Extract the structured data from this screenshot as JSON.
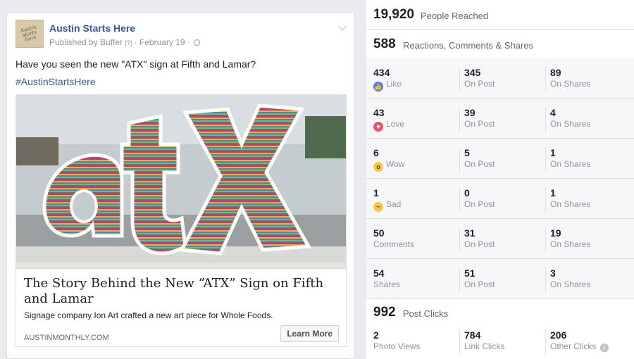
{
  "post": {
    "page_name": "Austin Starts Here",
    "avatar_text": "Austin starts here",
    "published_by": "Published by Buffer",
    "help_mark": "[?]",
    "separator": "·",
    "date": "February 19",
    "text": "Have you seen the new \"ATX\" sign at Fifth and Lamar?",
    "hashtag": "#AustinStartsHere",
    "link": {
      "title": "The Story Behind the New “ATX” Sign on Fifth and Lamar",
      "description": "Signage company Ion Art crafted a new art piece for Whole Foods.",
      "domain": "AUSTINMONTHLY.COM",
      "cta": "Learn More"
    }
  },
  "stats": {
    "reached": {
      "value": "19,920",
      "label": "People Reached"
    },
    "engagement": {
      "value": "588",
      "label": "Reactions, Comments & Shares"
    },
    "rows": [
      {
        "icon": "like-icon",
        "icon_glyph": "👍",
        "total": "434",
        "label": "Like",
        "on_post": "345",
        "on_post_label": "On Post",
        "on_shares": "89",
        "on_shares_label": "On Shares"
      },
      {
        "icon": "love-icon",
        "icon_glyph": "♥",
        "total": "43",
        "label": "Love",
        "on_post": "39",
        "on_post_label": "On Post",
        "on_shares": "4",
        "on_shares_label": "On Shares"
      },
      {
        "icon": "wow-icon",
        "icon_glyph": "o",
        "total": "6",
        "label": "Wow",
        "on_post": "5",
        "on_post_label": "On Post",
        "on_shares": "1",
        "on_shares_label": "On Shares"
      },
      {
        "icon": "sad-icon",
        "icon_glyph": "~",
        "total": "1",
        "label": "Sad",
        "on_post": "0",
        "on_post_label": "On Post",
        "on_shares": "1",
        "on_shares_label": "On Shares"
      },
      {
        "total": "50",
        "label": "Comments",
        "on_post": "31",
        "on_post_label": "On Post",
        "on_shares": "19",
        "on_shares_label": "On Shares"
      },
      {
        "total": "54",
        "label": "Shares",
        "on_post": "51",
        "on_post_label": "On Post",
        "on_shares": "3",
        "on_shares_label": "On Shares"
      }
    ],
    "clicks": {
      "value": "992",
      "label": "Post Clicks",
      "photo_views": "2",
      "photo_views_label": "Photo Views",
      "link_clicks": "784",
      "link_clicks_label": "Link Clicks",
      "other_clicks": "206",
      "other_clicks_label": "Other Clicks"
    }
  }
}
